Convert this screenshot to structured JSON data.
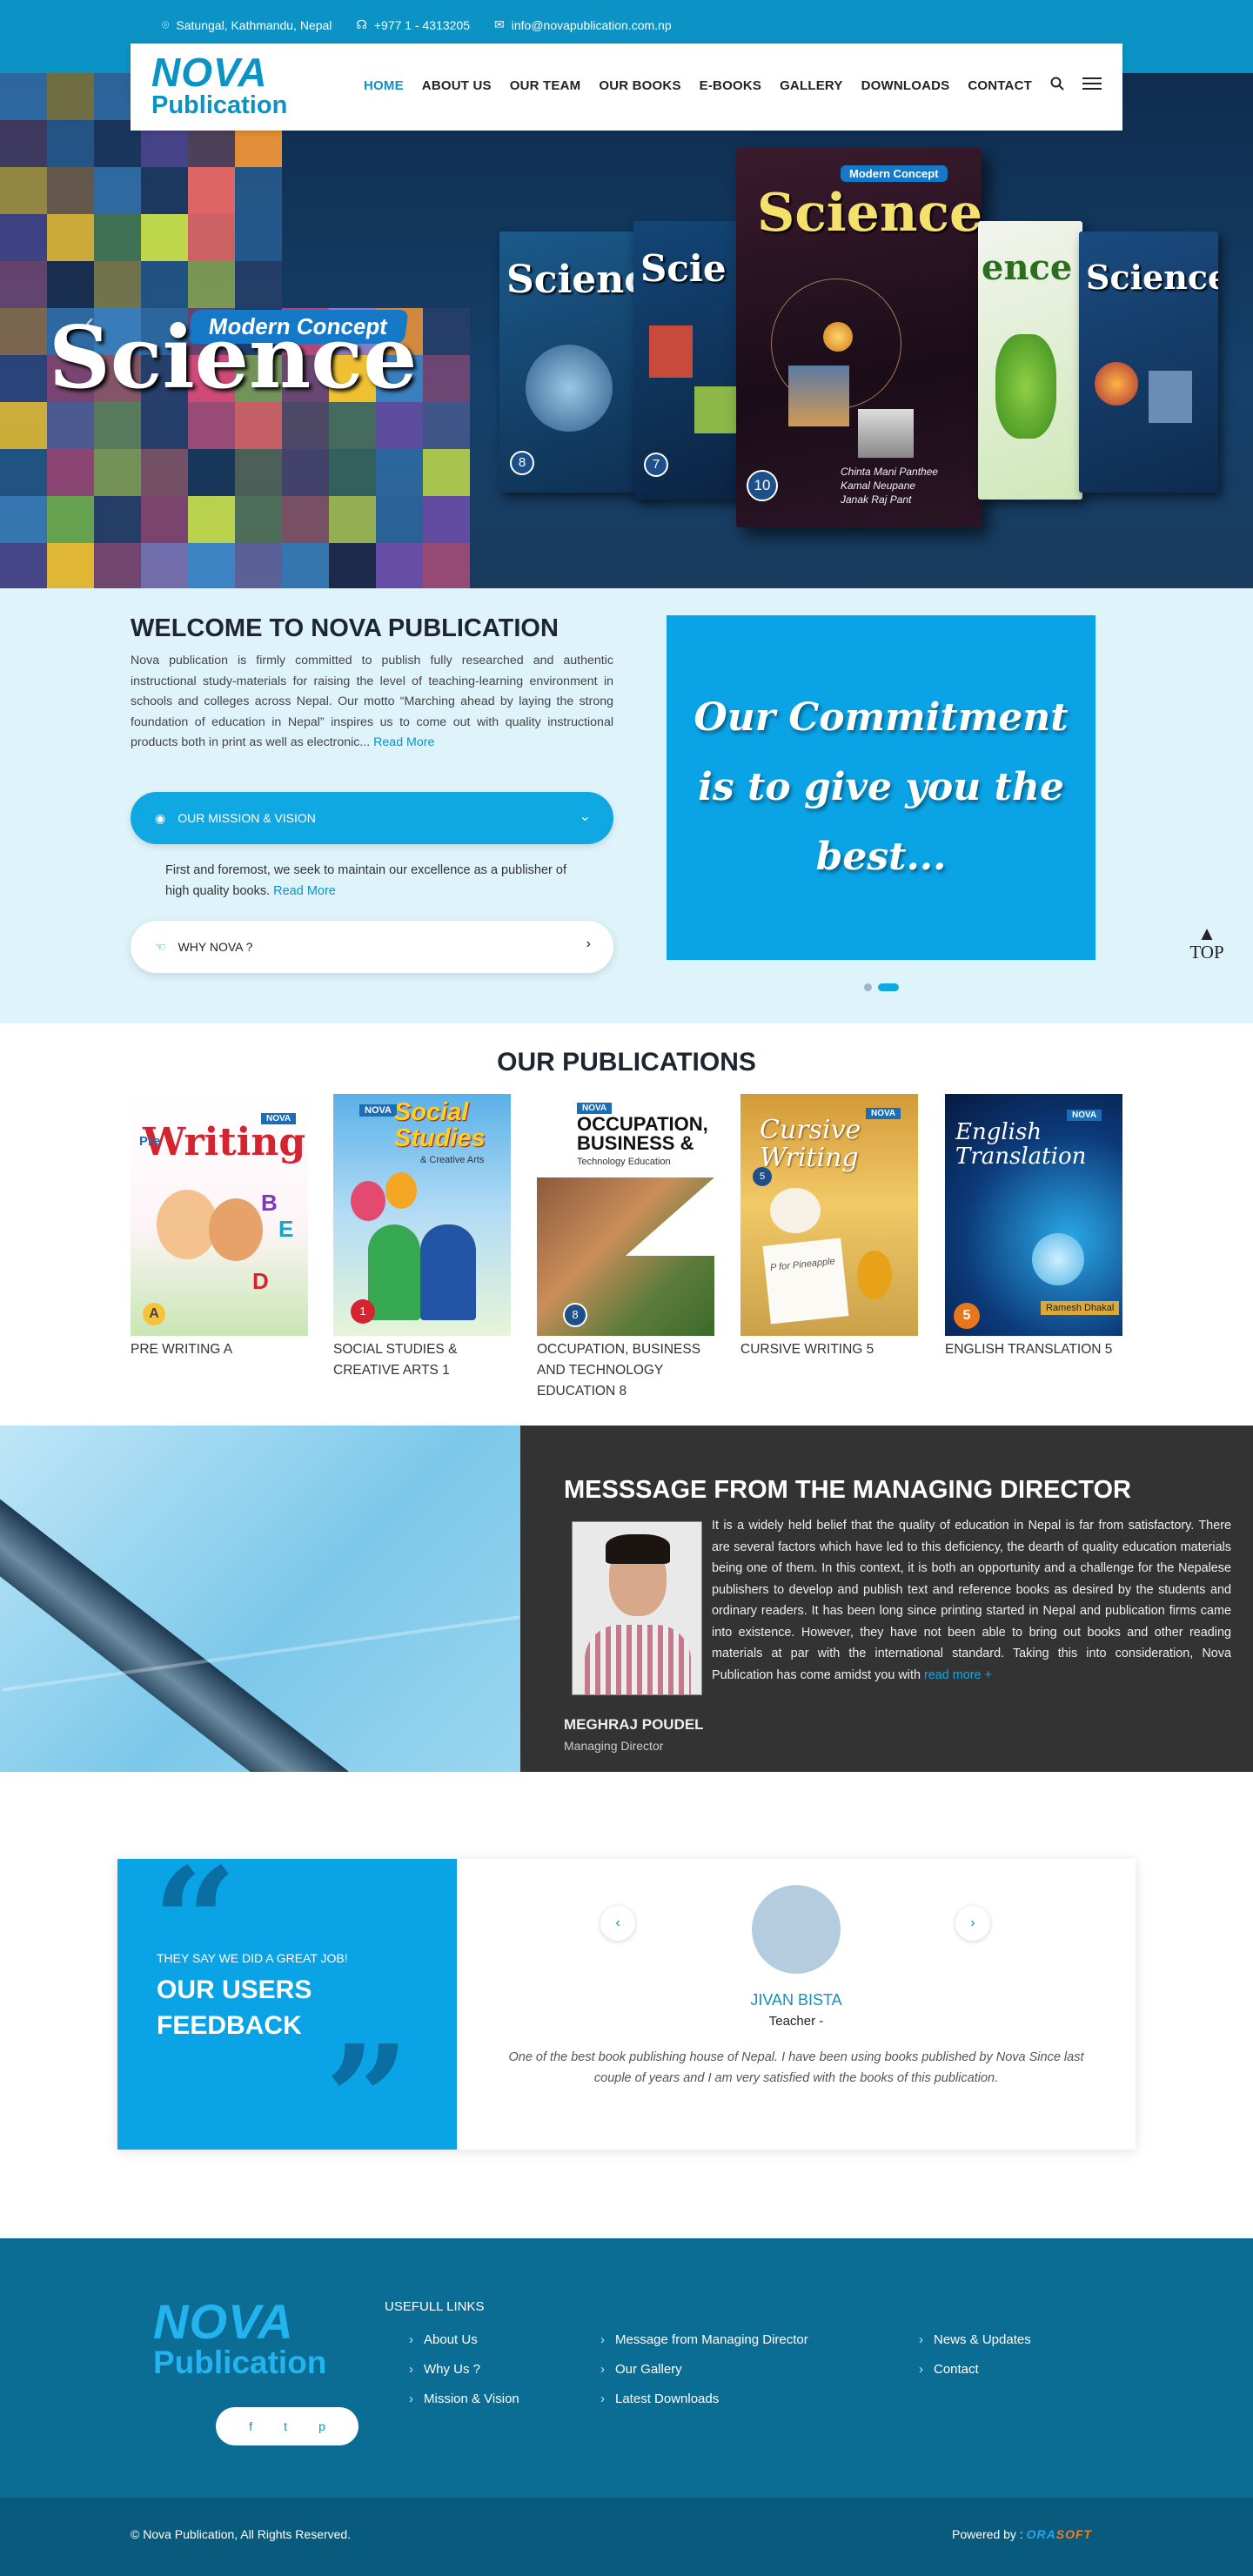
{
  "topbar": {
    "address": "Satungal, Kathmandu, Nepal",
    "phone": "+977 1 - 4313205",
    "email": "info@novapublication.com.np"
  },
  "brand": {
    "line1": "NOVA",
    "line2": "Publication"
  },
  "nav": [
    "HOME",
    "ABOUT US",
    "OUR TEAM",
    "OUR BOOKS",
    "E-BOOKS",
    "GALLERY",
    "DOWNLOADS",
    "CONTACT"
  ],
  "hero": {
    "badge": "Modern Concept",
    "title": "Science",
    "books": [
      {
        "title": "Science",
        "num": "8"
      },
      {
        "title": "Scie",
        "num": "7"
      },
      {
        "title": "Science",
        "num": "10",
        "authors": "Chinta Mani Panthee\nKamal Neupane\nJanak Raj Pant"
      },
      {
        "title": "ence",
        "num": ""
      },
      {
        "title": "Science",
        "num": ""
      }
    ]
  },
  "welcome": {
    "title": "WELCOME TO NOVA PUBLICATION",
    "text": "Nova publication is firmly committed to publish fully researched and authentic instructional study-materials for raising the level of teaching-learning environment in schools and colleges across Nepal. Our motto “Marching ahead by laying the strong foundation of education in Nepal” inspires us to come out with quality instructional products both in print as well as electronic... ",
    "read_more": "Read More",
    "mission_label": "OUR MISSION & VISION",
    "mission_text": "First and foremost, we seek to maintain our excellence as a publisher of high quality books. ",
    "mission_more": "Read More",
    "why_label": "WHY NOVA ?",
    "commitment": "Our Commitment is to give you the best...",
    "top_label": "TOP"
  },
  "publications": {
    "title": "OUR PUBLICATIONS",
    "items": [
      {
        "name": "PRE WRITING A",
        "cover_title": "Writing",
        "cover_sub": "Pre"
      },
      {
        "name": "SOCIAL STUDIES & CREATIVE ARTS 1",
        "cover_title": "Social Studies",
        "cover_sub": "& Creative Arts"
      },
      {
        "name": "OCCUPATION, BUSINESS AND TECHNOLOGY EDUCATION 8",
        "cover_title": "OCCUPATION, BUSINESS &",
        "cover_sub": "Technology Education"
      },
      {
        "name": "CURSIVE WRITING 5",
        "cover_title": "Cursive Writing",
        "cover_sub": "P for Pineapple"
      },
      {
        "name": "ENGLISH TRANSLATION 5",
        "cover_title": "English Translation",
        "cover_sub": "Ramesh Dhakal"
      }
    ]
  },
  "message": {
    "title": "MESSSAGE FROM THE MANAGING DIRECTOR",
    "text": "It is a widely held belief that the quality of education in Nepal is far from satisfactory. There are several factors which have led to this deficiency, the dearth of quality education materials being one of them. In this context, it is both an opportunity and a challenge for the Nepalese publishers to develop and publish text and reference books as desired by the students and ordinary readers. It has been long since printing started in Nepal and publication firms came into existence. However, they have not been able to bring out books and other reading materials at par with the international standard. Taking this into consideration, Nova Publication has come amidst you with ",
    "read_more": "read more  +",
    "name": "MEGHRAJ POUDEL",
    "role": "Managing Director"
  },
  "feedback": {
    "subtitle": "THEY SAY WE DID A GREAT JOB!",
    "title_line1": "OUR USERS",
    "title_line2": "FEEDBACK",
    "name": "JIVAN BISTA",
    "role": "Teacher -",
    "quote": "One of the best book publishing house of Nepal. I have been using books published by Nova Since last couple of years and I am very satisfied with the books of this publication."
  },
  "footer": {
    "useful_heading": "USEFULL LINKS",
    "col1": [
      "About Us",
      "Why Us ?",
      "Mission & Vision"
    ],
    "col2": [
      "Message from Managing Director",
      "Our Gallery",
      "Latest Downloads"
    ],
    "col3": [
      "News & Updates",
      "Contact"
    ],
    "social": [
      "f",
      "t",
      "p"
    ],
    "copyright": "© Nova Publication, All Rights Reserved.",
    "powered_by": "Powered by : ",
    "powered_brand_a": "ORA",
    "powered_brand_b": "SOFT"
  },
  "colors": {
    "primary": "#0a93c4",
    "accent": "#0fa8e3",
    "dark": "#333333",
    "footer": "#0b6c94"
  }
}
